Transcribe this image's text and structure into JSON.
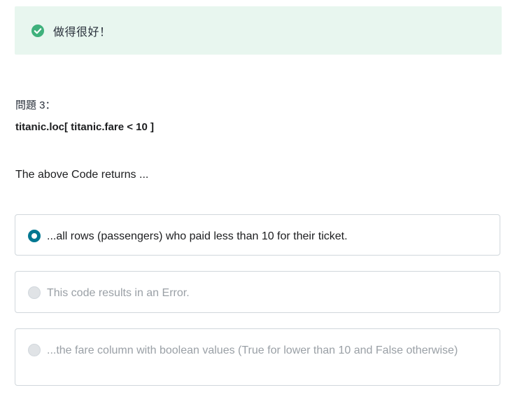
{
  "feedback": {
    "icon": "check-circle-icon",
    "message": "做得很好！",
    "color": "#3fb17c",
    "background": "#e8f6ef"
  },
  "question": {
    "number_label": "問題 3：",
    "code": "titanic.loc[ titanic.fare < 10 ]",
    "text": "The above Code returns ..."
  },
  "answers": [
    {
      "label": "...all rows (passengers) who paid less than 10 for their ticket.",
      "selected": true,
      "disabled": false
    },
    {
      "label": "This code results in an Error.",
      "selected": false,
      "disabled": true
    },
    {
      "label": "...the fare column with boolean values (True for lower than 10 and False otherwise)",
      "selected": false,
      "disabled": true
    }
  ],
  "colors": {
    "accent": "#007791",
    "disabled_text": "#9aa0a6",
    "border": "#d1d7dc"
  }
}
